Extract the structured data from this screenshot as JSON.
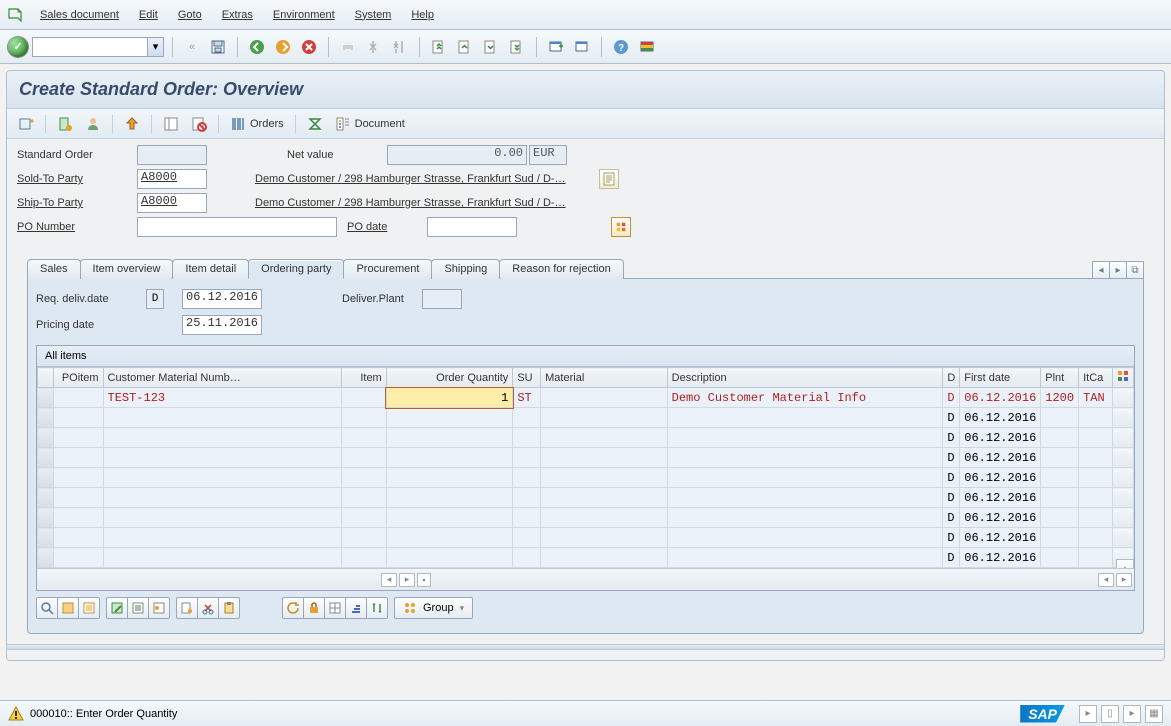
{
  "menu": {
    "items": [
      "Sales document",
      "Edit",
      "Goto",
      "Extras",
      "Environment",
      "System",
      "Help"
    ]
  },
  "title": "Create Standard Order: Overview",
  "subtoolbar": {
    "orders_label": "Orders",
    "document_label": "Document"
  },
  "header_fields": {
    "standard_order_label": "Standard Order",
    "standard_order_value": "",
    "net_value_label": "Net value",
    "net_value_value": "0.00",
    "currency": "EUR",
    "sold_to_label": "Sold-To Party",
    "sold_to_value": "A8000",
    "sold_to_desc": "Demo Customer / 298 Hamburger Strasse, Frankfurt Sud / D-…",
    "ship_to_label": "Ship-To Party",
    "ship_to_value": "A8000",
    "ship_to_desc": "Demo Customer / 298 Hamburger Strasse, Frankfurt Sud / D-…",
    "po_number_label": "PO Number",
    "po_number_value": "",
    "po_date_label": "PO date",
    "po_date_value": ""
  },
  "tabs": [
    "Sales",
    "Item overview",
    "Item detail",
    "Ordering party",
    "Procurement",
    "Shipping",
    "Reason for rejection"
  ],
  "active_tab": 3,
  "panel": {
    "req_deliv_label": "Req. deliv.date",
    "date_type": "D",
    "req_deliv_value": "06.12.2016",
    "deliver_plant_label": "Deliver.Plant",
    "deliver_plant_value": "",
    "pricing_date_label": "Pricing date",
    "pricing_date_value": "25.11.2016"
  },
  "grid": {
    "title": "All items",
    "columns": [
      "POitem",
      "Customer Material Numb…",
      "Item",
      "Order Quantity",
      "SU",
      "Material",
      "Description",
      "D",
      "First date",
      "Plnt",
      "ItCa"
    ],
    "rows": [
      {
        "poitem": "",
        "cmn": "TEST-123",
        "item": "",
        "qty": "1",
        "su": "ST",
        "material": "",
        "desc": "Demo Customer Material Info",
        "d": "D",
        "firstdate": "06.12.2016",
        "plnt": "1200",
        "itca": "TAN",
        "red": true,
        "editing": true
      },
      {
        "d": "D",
        "firstdate": "06.12.2016"
      },
      {
        "d": "D",
        "firstdate": "06.12.2016"
      },
      {
        "d": "D",
        "firstdate": "06.12.2016"
      },
      {
        "d": "D",
        "firstdate": "06.12.2016"
      },
      {
        "d": "D",
        "firstdate": "06.12.2016"
      },
      {
        "d": "D",
        "firstdate": "06.12.2016"
      },
      {
        "d": "D",
        "firstdate": "06.12.2016"
      },
      {
        "d": "D",
        "firstdate": "06.12.2016"
      }
    ]
  },
  "group_button_label": "Group",
  "status": {
    "message": "000010:: Enter Order Quantity"
  }
}
